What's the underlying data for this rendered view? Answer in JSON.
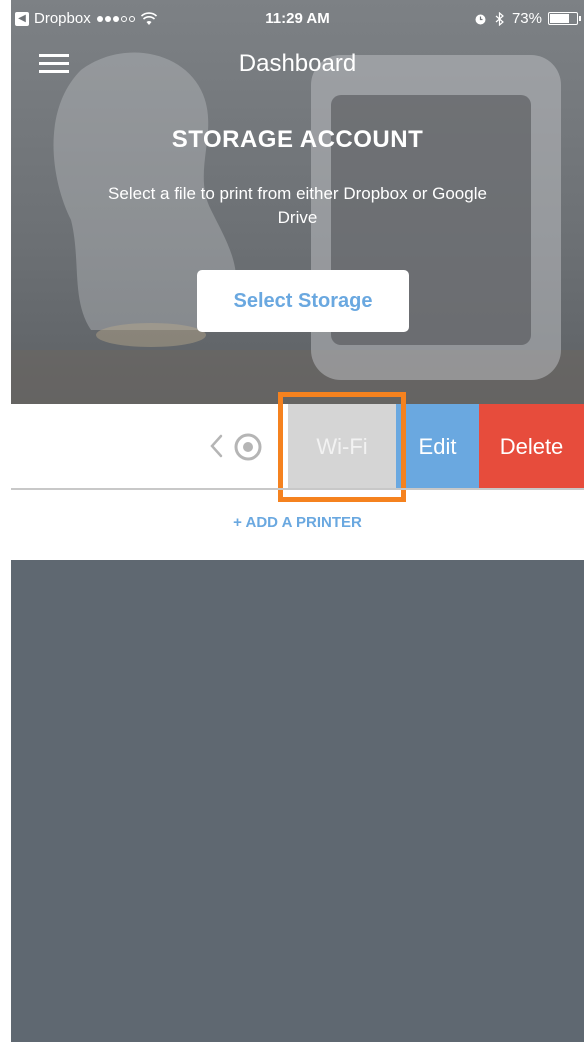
{
  "status_bar": {
    "back_app": "Dropbox",
    "time": "11:29 AM",
    "battery": "73%",
    "battery_level": 0.73,
    "signal_bars_filled": 3,
    "signal_bars_total": 5
  },
  "nav": {
    "title": "Dashboard",
    "menu_icon": "hamburger-menu-icon"
  },
  "hero": {
    "title": "STORAGE ACCOUNT",
    "subtitle": "Select a file to print from either Dropbox or Google Drive",
    "button_label": "Select Storage"
  },
  "printer_row": {
    "actions": {
      "wifi_label": "Wi-Fi",
      "edit_label": "Edit",
      "delete_label": "Delete"
    }
  },
  "add_printer_label": "+ ADD A PRINTER",
  "colors": {
    "accent_blue": "#6aa8e0",
    "delete_red": "#e74c3c",
    "highlight_orange": "#f5821f",
    "panel_gray": "#5f6871"
  }
}
